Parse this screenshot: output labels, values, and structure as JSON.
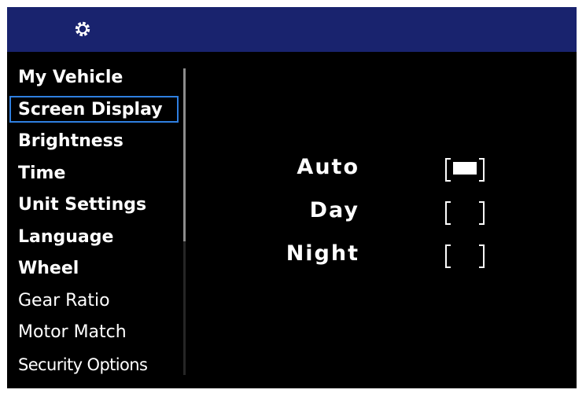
{
  "header": {
    "icon": "gear-icon"
  },
  "menu": {
    "items": [
      {
        "label": "My Vehicle",
        "selected": false
      },
      {
        "label": "Screen Display",
        "selected": true
      },
      {
        "label": "Brightness",
        "selected": false
      },
      {
        "label": "Time",
        "selected": false
      },
      {
        "label": "Unit Settings",
        "selected": false
      },
      {
        "label": "Language",
        "selected": false
      },
      {
        "label": "Wheel",
        "selected": false
      },
      {
        "label": "Gear Ratio",
        "selected": false
      },
      {
        "label": "Motor Match",
        "selected": false
      },
      {
        "label": "Security Options",
        "selected": false
      }
    ]
  },
  "display_mode": {
    "options": [
      {
        "label": "Auto",
        "checked": true
      },
      {
        "label": "Day",
        "checked": false
      },
      {
        "label": "Night",
        "checked": false
      }
    ]
  },
  "colors": {
    "header_bar": "#19236e",
    "background": "#000000",
    "selection_outline": "#2f7fe0",
    "text": "#ffffff"
  }
}
